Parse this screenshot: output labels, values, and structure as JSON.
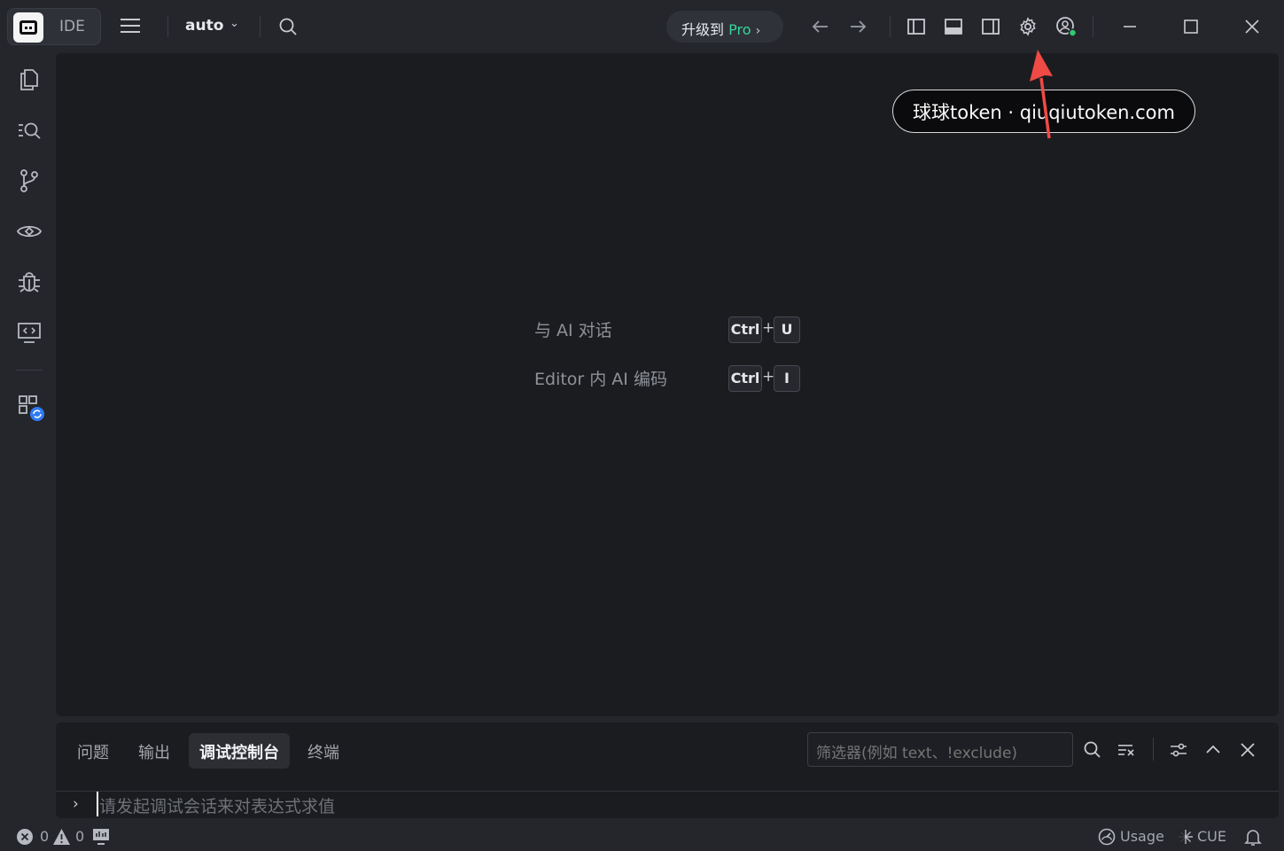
{
  "titlebar": {
    "app_label": "IDE",
    "model_selector": "auto",
    "upgrade": {
      "prefix": "升级到",
      "pro": "Pro",
      "chevron": "›"
    }
  },
  "editor": {
    "hints": [
      {
        "label": "与 AI 对话",
        "keys": [
          "Ctrl",
          "U"
        ],
        "plus": "+"
      },
      {
        "label": "Editor 内 AI 编码",
        "keys": [
          "Ctrl",
          "I"
        ],
        "plus": "+"
      }
    ]
  },
  "tooltip": {
    "text": "球球token · qiuqiutoken.com"
  },
  "panel": {
    "tabs": [
      "问题",
      "输出",
      "调试控制台",
      "终端"
    ],
    "active_tab": "调试控制台",
    "filter_placeholder": "筛选器(例如 text、!exclude)",
    "console_placeholder": "请发起调试会话来对表达式求值"
  },
  "statusbar": {
    "errors": "0",
    "warnings": "0",
    "usage": "Usage",
    "cue": "CUE"
  },
  "colors": {
    "accent_pro": "#35d59a",
    "badge_blue": "#2f7bf5",
    "status_online": "#2ecc71",
    "annotation_arrow": "#f04a44"
  }
}
